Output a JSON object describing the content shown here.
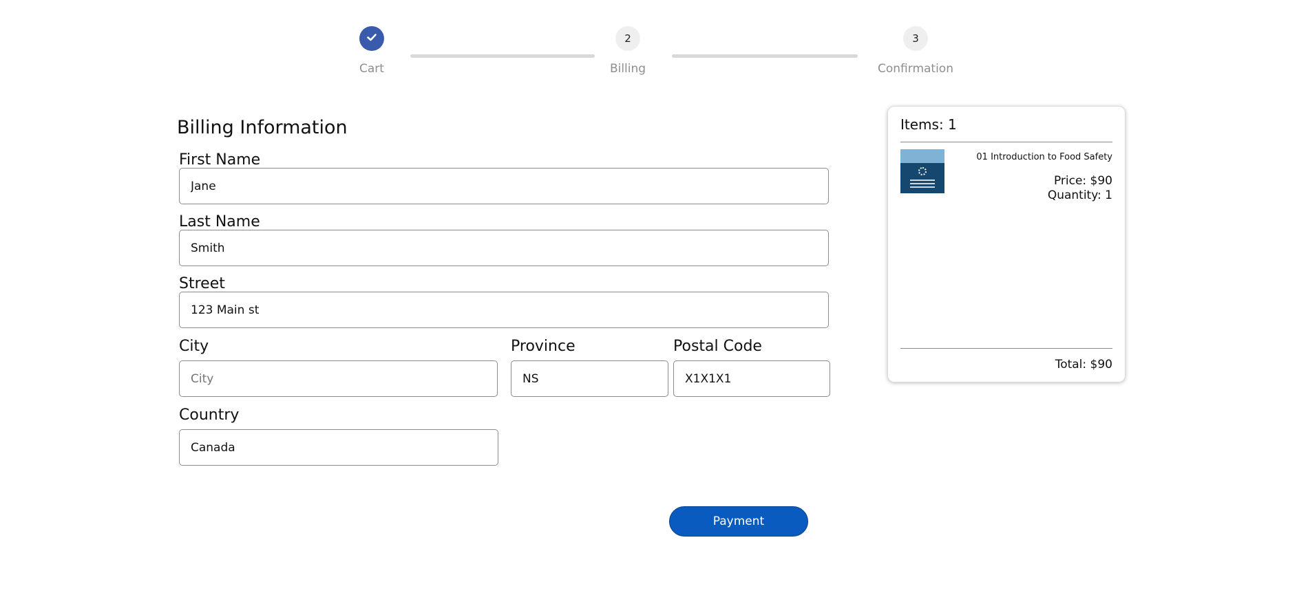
{
  "stepper": {
    "steps": [
      {
        "number": "",
        "label": "Cart",
        "status": "complete"
      },
      {
        "number": "2",
        "label": "Billing",
        "status": "current"
      },
      {
        "number": "3",
        "label": "Confirmation",
        "status": "upcoming"
      }
    ]
  },
  "form": {
    "title": "Billing Information",
    "first_name": {
      "label": "First Name",
      "value": "Jane"
    },
    "last_name": {
      "label": "Last Name",
      "value": "Smith"
    },
    "street": {
      "label": "Street",
      "value": "123 Main st"
    },
    "city": {
      "label": "City",
      "placeholder": "City"
    },
    "province": {
      "label": "Province",
      "value": "NS"
    },
    "postal_code": {
      "label": "Postal Code",
      "value": "X1X1X1"
    },
    "country": {
      "label": "Country",
      "value": "Canada"
    },
    "submit_label": "Payment"
  },
  "summary": {
    "items_count": "Items: 1",
    "item": {
      "name": "01 Introduction to Food Safety",
      "price": "Price: $90",
      "quantity": "Quantity: 1",
      "thumbnail_icon": "course-cover-image"
    },
    "total": "Total: $90"
  },
  "colors": {
    "step_complete": "#3a5bab",
    "button_bg": "#0a5bbf"
  }
}
